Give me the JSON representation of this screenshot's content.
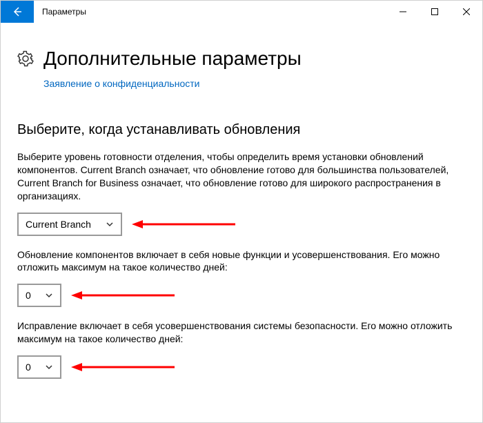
{
  "titlebar": {
    "title": "Параметры"
  },
  "header": {
    "title": "Дополнительные параметры",
    "privacy_link": "Заявление о конфиденциальности"
  },
  "section": {
    "heading": "Выберите, когда устанавливать обновления",
    "desc1": "Выберите уровень готовности отделения, чтобы определить время установки обновлений компонентов. Current Branch означает, что обновление готово для большинства пользователей, Current Branch for Business означает, что обновление готово для широкого распространения в организациях.",
    "branch_value": "Current Branch",
    "desc2": "Обновление компонентов включает в себя новые функции и усовершенствования. Его можно отложить максимум на такое количество дней:",
    "days1_value": "0",
    "desc3": "Исправление включает в себя усовершенствования системы безопасности. Его можно отложить максимум на такое количество дней:",
    "days2_value": "0"
  },
  "annotation_color": "#ff0000"
}
